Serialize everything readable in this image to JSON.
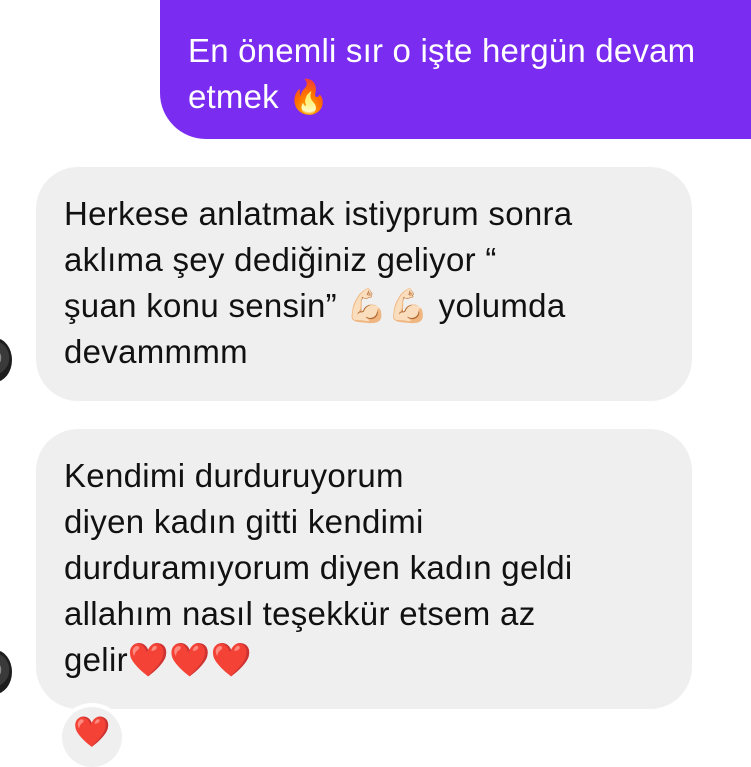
{
  "messages": {
    "sent_1": {
      "text": "En önemli sır o işte hergün devam\netmek 🔥"
    },
    "received_1": {
      "text": "Herkese anlatmak istiyprum sonra\naklıma şey dediğiniz geliyor “\nşuan konu sensin” 💪🏻💪🏻 yolumda\ndevammmm"
    },
    "received_2": {
      "text": "Kendimi durduruyorum\ndiyen kadın gitti kendimi\ndurduramıyorum diyen kadın geldi\nallahım nasıl teşekkür etsem az\ngelir❤️❤️❤️"
    }
  },
  "reaction": {
    "emoji": "❤️"
  },
  "colors": {
    "sent_bubble": "#7a2cf0",
    "received_bubble": "#efefef",
    "received_text": "#111111",
    "sent_text": "#ffffff"
  }
}
